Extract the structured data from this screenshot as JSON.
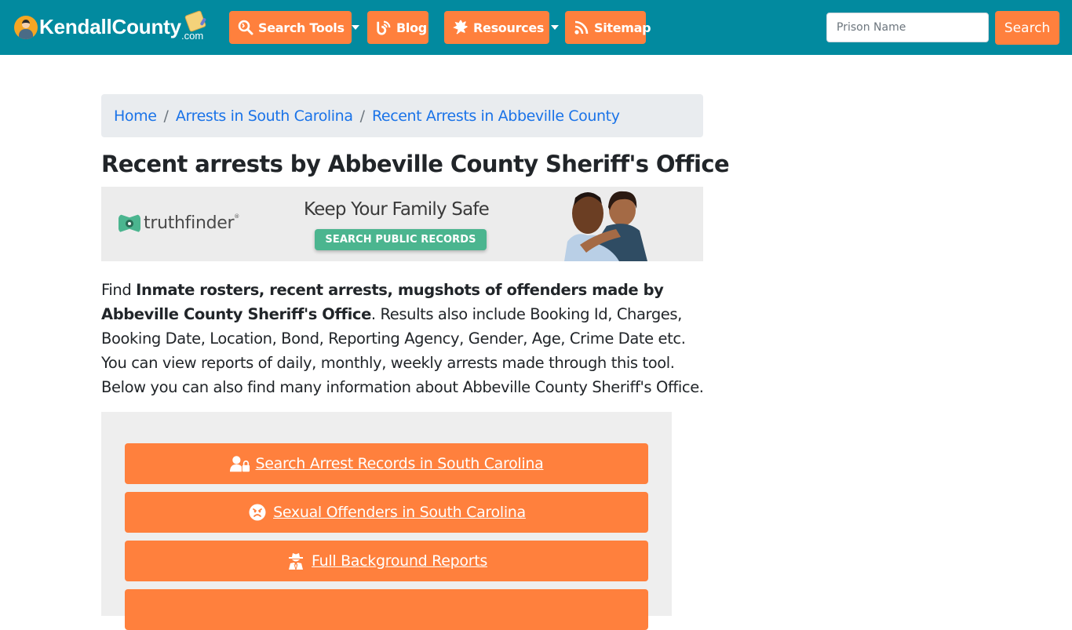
{
  "site": {
    "logo_text": "KendallCounty",
    "logo_suffix": ".com"
  },
  "navbar": {
    "items": [
      {
        "label": "Search Tools",
        "icon": "search-tools-icon",
        "dropdown": true
      },
      {
        "label": "Blog",
        "icon": "blog-icon",
        "dropdown": false
      },
      {
        "label": "Resources",
        "icon": "leaf-icon",
        "dropdown": true
      },
      {
        "label": "Sitemap",
        "icon": "rss-icon",
        "dropdown": false
      }
    ],
    "search": {
      "placeholder": "Prison Name",
      "value": "",
      "button_label": "Search"
    }
  },
  "breadcrumb": [
    {
      "label": "Home"
    },
    {
      "label": "Arrests in South Carolina"
    },
    {
      "label": "Recent Arrests in Abbeville County"
    }
  ],
  "breadcrumb_separator": "/",
  "page": {
    "title": "Recent arrests by Abbeville County Sheriff's Office",
    "description": {
      "prefix": "Find ",
      "bold": "Inmate rosters, recent arrests, mugshots of offenders made by Abbeville County Sheriff's Office",
      "suffix": ". Results also include Booking Id, Charges, Booking Date, Location, Bond, Reporting Agency, Gender, Age, Crime Date etc. You can view reports of daily, monthly, weekly arrests made through this tool. Below you can also find many information about Abbeville County Sheriff's Office."
    }
  },
  "ad": {
    "brand": "truthfinder",
    "brand_mark": "®",
    "headline": "Keep Your Family Safe",
    "cta": "SEARCH PUBLIC RECORDS",
    "accent_color": "#4bb58f"
  },
  "link_buttons": [
    {
      "label": "Search Arrest Records in South Carolina",
      "icon": "user-lock-icon"
    },
    {
      "label": "Sexual Offenders in South Carolina",
      "icon": "angry-face-icon"
    },
    {
      "label": "Full Background Reports",
      "icon": "user-secret-icon"
    },
    {
      "label": "",
      "icon": "unknown-icon"
    }
  ],
  "colors": {
    "navbar_bg": "#028a9f",
    "accent_orange": "#ff803d",
    "link_blue": "#1a73e8",
    "breadcrumb_bg": "#e9ecef",
    "panel_bg": "#eeeeee"
  }
}
